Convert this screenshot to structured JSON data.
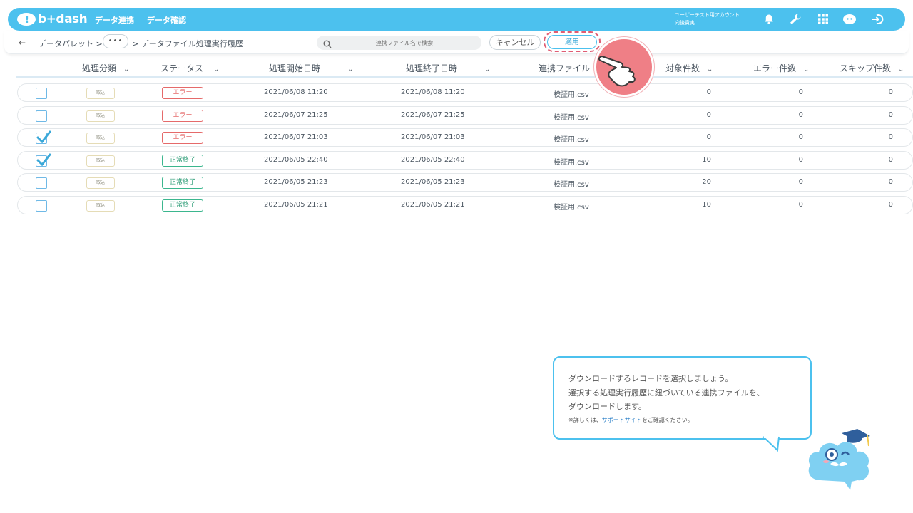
{
  "header": {
    "logo_text": "b+dash",
    "nav": [
      "データ連携",
      "データ確認"
    ],
    "account_line1": "ユーザーテスト用アカウント",
    "account_line2": "向後貴実",
    "colors": {
      "accent": "#4cc1ee",
      "error": "#e56a6a",
      "success": "#3bb68e",
      "highlight": "#e05d73"
    }
  },
  "toolbar": {
    "crumb_1": "データパレット >",
    "crumb_more": "•••",
    "crumb_2": "> データファイル処理実行履歴",
    "search_placeholder": "連携ファイル名で検索",
    "cancel_label": "キャンセル",
    "apply_label": "適用"
  },
  "table": {
    "columns": [
      "処理分類",
      "ステータス",
      "処理開始日時",
      "処理終了日時",
      "連携ファイル",
      "対象件数",
      "エラー件数",
      "スキップ件数"
    ],
    "rows": [
      {
        "checked": false,
        "type": "取込",
        "status": "エラー",
        "status_kind": "err",
        "start": "2021/06/08 11:20",
        "end": "2021/06/08 11:20",
        "file": "検証用.csv",
        "count": "0",
        "errors": "0",
        "skips": "0"
      },
      {
        "checked": false,
        "type": "取込",
        "status": "エラー",
        "status_kind": "err",
        "start": "2021/06/07 21:25",
        "end": "2021/06/07 21:25",
        "file": "検証用.csv",
        "count": "0",
        "errors": "0",
        "skips": "0"
      },
      {
        "checked": true,
        "type": "取込",
        "status": "エラー",
        "status_kind": "err",
        "start": "2021/06/07 21:03",
        "end": "2021/06/07 21:03",
        "file": "検証用.csv",
        "count": "0",
        "errors": "0",
        "skips": "0"
      },
      {
        "checked": true,
        "type": "取込",
        "status": "正常終了",
        "status_kind": "ok",
        "start": "2021/06/05 22:40",
        "end": "2021/06/05 22:40",
        "file": "検証用.csv",
        "count": "10",
        "errors": "0",
        "skips": "0"
      },
      {
        "checked": false,
        "type": "取込",
        "status": "正常終了",
        "status_kind": "ok",
        "start": "2021/06/05 21:23",
        "end": "2021/06/05 21:23",
        "file": "検証用.csv",
        "count": "20",
        "errors": "0",
        "skips": "0"
      },
      {
        "checked": false,
        "type": "取込",
        "status": "正常終了",
        "status_kind": "ok",
        "start": "2021/06/05 21:21",
        "end": "2021/06/05 21:21",
        "file": "検証用.csv",
        "count": "10",
        "errors": "0",
        "skips": "0"
      }
    ]
  },
  "tooltip": {
    "line1": "ダウンロードするレコードを選択しましょう。",
    "line2": "選択する処理実行履歴に紐づいている連携ファイルを、",
    "line3": "ダウンロードします。",
    "note_prefix": "※詳しくは、",
    "note_link": "サポートサイト",
    "note_suffix": "をご確認ください。"
  },
  "icons": [
    "bell-icon",
    "wrench-icon",
    "grid-icon",
    "cloud-avatar-icon",
    "logout-icon",
    "search-icon",
    "pointer-hand-icon"
  ]
}
